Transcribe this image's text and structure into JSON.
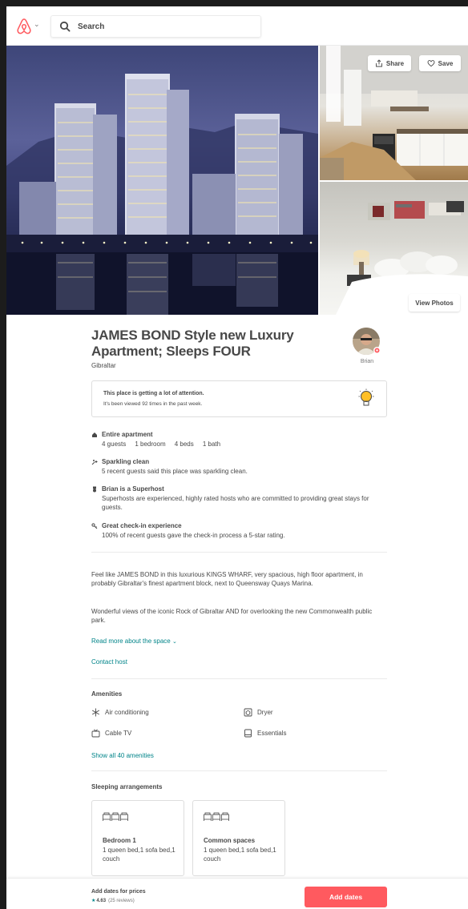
{
  "header": {
    "search_placeholder": "Search"
  },
  "gallery": {
    "share_label": "Share",
    "save_label": "Save",
    "view_photos_label": "View Photos"
  },
  "listing": {
    "title": "JAMES BOND Style new Luxury Apartment; Sleeps FOUR",
    "location": "Gibraltar",
    "host_name": "Brian"
  },
  "notice": {
    "title": "This place is getting a lot of attention.",
    "subtitle": "It's been viewed 92 times in the past week."
  },
  "highlights": [
    {
      "icon": "home-icon",
      "title": "Entire apartment",
      "desc": "4 guests     1 bedroom     4 beds     1 bath"
    },
    {
      "icon": "sparkle-icon",
      "title": "Sparkling clean",
      "desc": "5 recent guests said this place was sparkling clean."
    },
    {
      "icon": "superhost-medal-icon",
      "title": "Brian is a Superhost",
      "desc": "Superhosts are experienced, highly rated hosts who are committed to providing great stays for guests."
    },
    {
      "icon": "key-icon",
      "title": "Great check-in experience",
      "desc": "100% of recent guests gave the check-in process a 5-star rating."
    }
  ],
  "description": {
    "para1": "Feel like JAMES BOND in this luxurious KINGS WHARF, very spacious, high floor apartment, in probably Gibraltar's finest apartment block, next to Queensway Quays Marina.",
    "para2": "Wonderful views of the iconic Rock of Gibraltar AND for overlooking the new Commonwealth public park.",
    "read_more": "Read more about the space",
    "contact_host": "Contact host"
  },
  "amenities": {
    "title": "Amenities",
    "items": [
      {
        "icon": "snowflake-icon",
        "label": "Air conditioning"
      },
      {
        "icon": "dryer-icon",
        "label": "Dryer"
      },
      {
        "icon": "tv-icon",
        "label": "Cable TV"
      },
      {
        "icon": "essentials-icon",
        "label": "Essentials"
      }
    ],
    "show_all": "Show all 40 amenities"
  },
  "sleeping": {
    "title": "Sleeping arrangements",
    "rooms": [
      {
        "title": "Bedroom 1",
        "desc": "1 queen bed,1 sofa bed,1 couch"
      },
      {
        "title": "Common spaces",
        "desc": "1 queen bed,1 sofa bed,1 couch"
      }
    ]
  },
  "footer": {
    "title": "Add dates for prices",
    "rating": "4.63",
    "reviews": "(25 reviews)",
    "cta": "Add dates"
  },
  "colors": {
    "brand": "#FF5A5F",
    "link": "#008489",
    "text": "#484848"
  }
}
